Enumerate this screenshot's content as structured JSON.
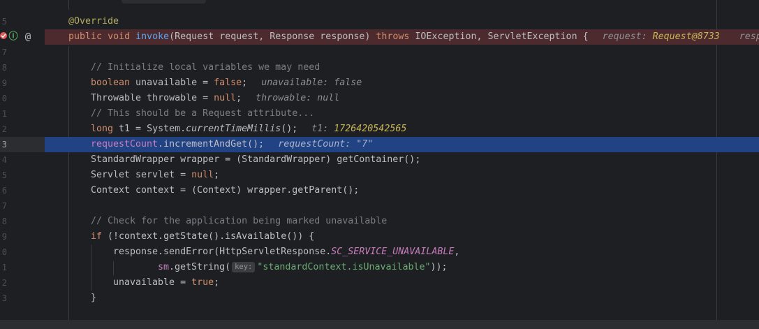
{
  "gutter": {
    "line_numbers": [
      "5",
      "7",
      "8",
      "9",
      "0",
      "1",
      "2",
      "3",
      "4",
      "5",
      "6",
      "7",
      "8",
      "9",
      "0",
      "1",
      "2",
      "3"
    ],
    "breakpoint_icon": "breakpoint-icon",
    "override_icon": "implements-icon",
    "annotation_icon": "at-icon",
    "override_glyph": "ⓘ",
    "at_glyph": "@"
  },
  "code": {
    "annotation": "@Override",
    "sig_public": "public",
    "sig_void": "void",
    "sig_method": "invoke",
    "sig_params": "(Request request, Response response) ",
    "sig_throws": "throws",
    "sig_rest": " IOException, ServletException {",
    "sig_hint_request_label": "request: ",
    "sig_hint_request_value": "Request@8733",
    "sig_hint_response_label": "resp",
    "l1_comment": "// Initialize local variables we may need",
    "l2_type": "boolean",
    "l2_mid": " unavailable = ",
    "l2_false": "false",
    "l2_end": ";",
    "l2_hint": "unavailable: false",
    "l3_start": "Throwable throwable = ",
    "l3_null": "null",
    "l3_end": ";",
    "l3_hint": "throwable: null",
    "l4_comment": "// This should be a Request attribute...",
    "l5_type": "long",
    "l5_mid": " t1 = System.",
    "l5_call": "currentTimeMillis",
    "l5_end": "();",
    "l5_hint_label": "t1: ",
    "l5_hint_value": "1726420542565",
    "l6_field": "requestCount",
    "l6_end": ".incrementAndGet();",
    "l6_hint": "requestCount: \"7\"",
    "l7_text": "StandardWrapper wrapper = (StandardWrapper) getContainer();",
    "l8_start": "Servlet servlet = ",
    "l8_null": "null",
    "l8_end": ";",
    "l9_text": "Context context = (Context) wrapper.getParent();",
    "l10_comment": "// Check for the application being marked unavailable",
    "l11_if": "if",
    "l11_rest": " (!context.getState().isAvailable()) {",
    "l12_start": "response.sendError(HttpServletResponse.",
    "l12_const": "SC_SERVICE_UNAVAILABLE",
    "l12_end": ",",
    "l13_sm": "sm",
    "l13_mid": ".getString(",
    "l13_param": "key:",
    "l13_str": "\"standardContext.isUnavailable\"",
    "l13_end": "));",
    "l14_start": "unavailable = ",
    "l14_true": "true",
    "l14_end": ";",
    "l15_text": "}"
  },
  "colors": {
    "background": "#1e1f22",
    "execution_line": "#214283",
    "breakpoint_line": "#4d2a2d",
    "keyword": "#cf8e6d",
    "method": "#56a8f5",
    "comment": "#7a7e85",
    "field": "#c77dbb",
    "string": "#6aab73"
  }
}
